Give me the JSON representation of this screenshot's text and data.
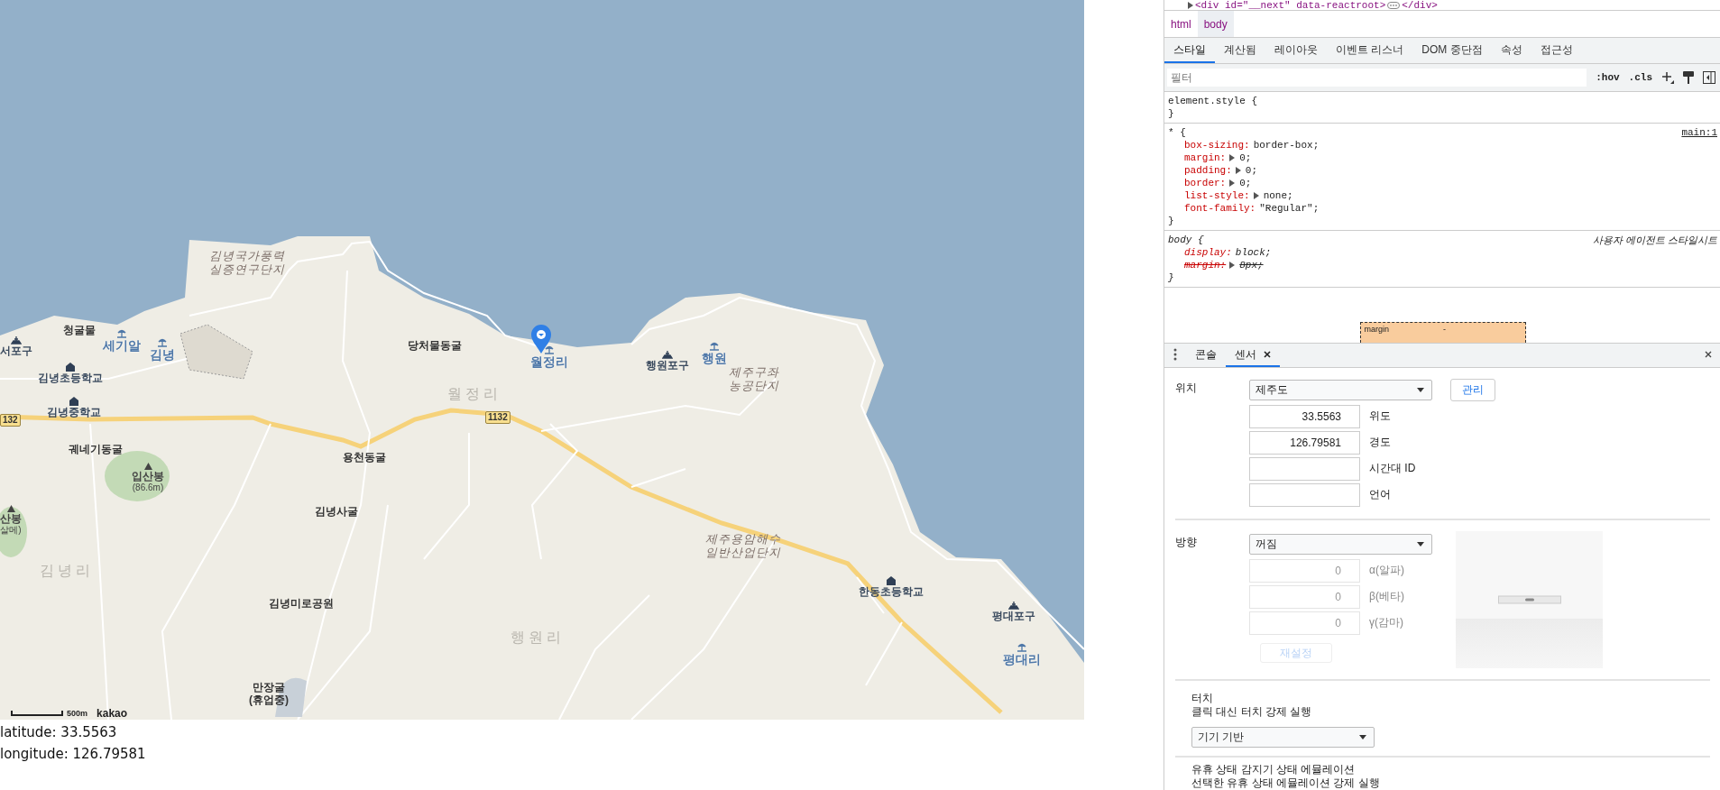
{
  "map": {
    "labels": [
      {
        "kind": "area",
        "lines": [
          "김녕국가풍력",
          "실증연구단지"
        ]
      },
      {
        "kind": "place",
        "lines": [
          "청굴물"
        ]
      },
      {
        "kind": "harbor",
        "lines": [
          "서포구"
        ]
      },
      {
        "kind": "beach",
        "lines": [
          "세기알"
        ]
      },
      {
        "kind": "beach",
        "lines": [
          "김녕"
        ]
      },
      {
        "kind": "place",
        "lines": [
          "당처물동굴"
        ]
      },
      {
        "kind": "beach",
        "lines": [
          "월정리"
        ]
      },
      {
        "kind": "harbor",
        "lines": [
          "행원포구"
        ]
      },
      {
        "kind": "beach",
        "lines": [
          "행원"
        ]
      },
      {
        "kind": "school",
        "lines": [
          "김녕초등학교"
        ]
      },
      {
        "kind": "area",
        "lines": [
          "제주구좌",
          "농공단지"
        ]
      },
      {
        "kind": "school",
        "lines": [
          "김녕중학교"
        ]
      },
      {
        "kind": "district",
        "lines": [
          "월정리"
        ]
      },
      {
        "kind": "road",
        "lines": [
          "132"
        ]
      },
      {
        "kind": "road",
        "lines": [
          "1132"
        ]
      },
      {
        "kind": "place",
        "lines": [
          "궤네기동굴"
        ]
      },
      {
        "kind": "place",
        "lines": [
          "용천동굴"
        ]
      },
      {
        "kind": "mountain",
        "lines": [
          "입산봉",
          "(86.6m)"
        ]
      },
      {
        "kind": "place",
        "lines": [
          "김녕사굴"
        ]
      },
      {
        "kind": "mountain",
        "lines": [
          "산봉",
          "살메)"
        ]
      },
      {
        "kind": "area",
        "lines": [
          "제주용암해수",
          "일반산업단지"
        ]
      },
      {
        "kind": "district",
        "lines": [
          "김녕리"
        ]
      },
      {
        "kind": "school",
        "lines": [
          "한동초등학교"
        ]
      },
      {
        "kind": "place",
        "lines": [
          "김녕미로공원"
        ]
      },
      {
        "kind": "harbor",
        "lines": [
          "평대포구"
        ]
      },
      {
        "kind": "district",
        "lines": [
          "행원리"
        ]
      },
      {
        "kind": "beach",
        "lines": [
          "평대리"
        ]
      },
      {
        "kind": "place",
        "lines": [
          "만장굴",
          "(휴업중)"
        ]
      }
    ],
    "scale_label": "500m",
    "attribution": "kakao"
  },
  "coords": [
    "latitude: 33.5563",
    "longitude: 126.79581"
  ],
  "devtools": {
    "element_line": {
      "open": "<div id=\"__next\" data-reactroot>",
      "close": "</div>"
    },
    "breadcrumbs": [
      {
        "label": "html",
        "selected": false
      },
      {
        "label": "body",
        "selected": true
      }
    ],
    "tabs": [
      {
        "label": "스타일",
        "selected": true
      },
      {
        "label": "계산됨",
        "selected": false
      },
      {
        "label": "레이아웃",
        "selected": false
      },
      {
        "label": "이벤트 리스너",
        "selected": false
      },
      {
        "label": "DOM 중단점",
        "selected": false
      },
      {
        "label": "속성",
        "selected": false
      },
      {
        "label": "접근성",
        "selected": false
      }
    ],
    "filter": {
      "placeholder": "필터"
    },
    "hov": ":hov",
    "cls": ".cls",
    "rules": [
      {
        "selector": "element.style {",
        "close": "}",
        "user_agent": false
      },
      {
        "selector": "* {",
        "source": "main:1",
        "close": "}",
        "user_agent": false,
        "declarations": [
          {
            "name": "box-sizing:",
            "value": "border-box;",
            "expandable": false,
            "struck": false
          },
          {
            "name": "margin:",
            "value": "0;",
            "expandable": true,
            "struck": false
          },
          {
            "name": "padding:",
            "value": "0;",
            "expandable": true,
            "struck": false
          },
          {
            "name": "border:",
            "value": "0;",
            "expandable": true,
            "struck": false
          },
          {
            "name": "list-style:",
            "value": "none;",
            "expandable": true,
            "struck": false
          },
          {
            "name": "font-family:",
            "value": "\"Regular\";",
            "expandable": false,
            "struck": false
          }
        ]
      },
      {
        "selector": "body {",
        "source": "사용자 에이전트 스타일시트",
        "close": "}",
        "user_agent": true,
        "declarations": [
          {
            "name": "display:",
            "value": "block;",
            "expandable": false,
            "struck": false
          },
          {
            "name": "margin:",
            "value": "8px;",
            "expandable": true,
            "struck": true
          }
        ]
      }
    ],
    "box_model": {
      "label": "margin",
      "value": "-"
    },
    "drawer_tabs": [
      {
        "label": "콘솔",
        "selected": false,
        "closable": false
      },
      {
        "label": "센서",
        "selected": true,
        "closable": true
      }
    ],
    "sensors": {
      "location": {
        "label": "위치",
        "select": "제주도",
        "manage": "관리",
        "fields": [
          {
            "value": "33.5563",
            "label": "위도"
          },
          {
            "value": "126.79581",
            "label": "경도"
          },
          {
            "label": "시간대 ID"
          },
          {
            "label": "언어"
          }
        ]
      },
      "orientation": {
        "label": "방향",
        "select": "꺼짐",
        "fields": [
          {
            "value": "0",
            "label": "α(알파)",
            "disabled": true
          },
          {
            "value": "0",
            "label": "β(베타)",
            "disabled": true
          },
          {
            "value": "0",
            "label": "γ(감마)",
            "disabled": true
          }
        ],
        "reset": {
          "label": "재설정",
          "disabled": true
        }
      },
      "touch": {
        "title": "터치",
        "description": "클릭 대신 터치 강제 실행",
        "select": "기기 기반"
      },
      "idle": {
        "title": "유휴 상태 감지기 상태 에뮬레이션",
        "description": "선택한 유휴 상태 에뮬레이션 강제 실행"
      }
    }
  }
}
